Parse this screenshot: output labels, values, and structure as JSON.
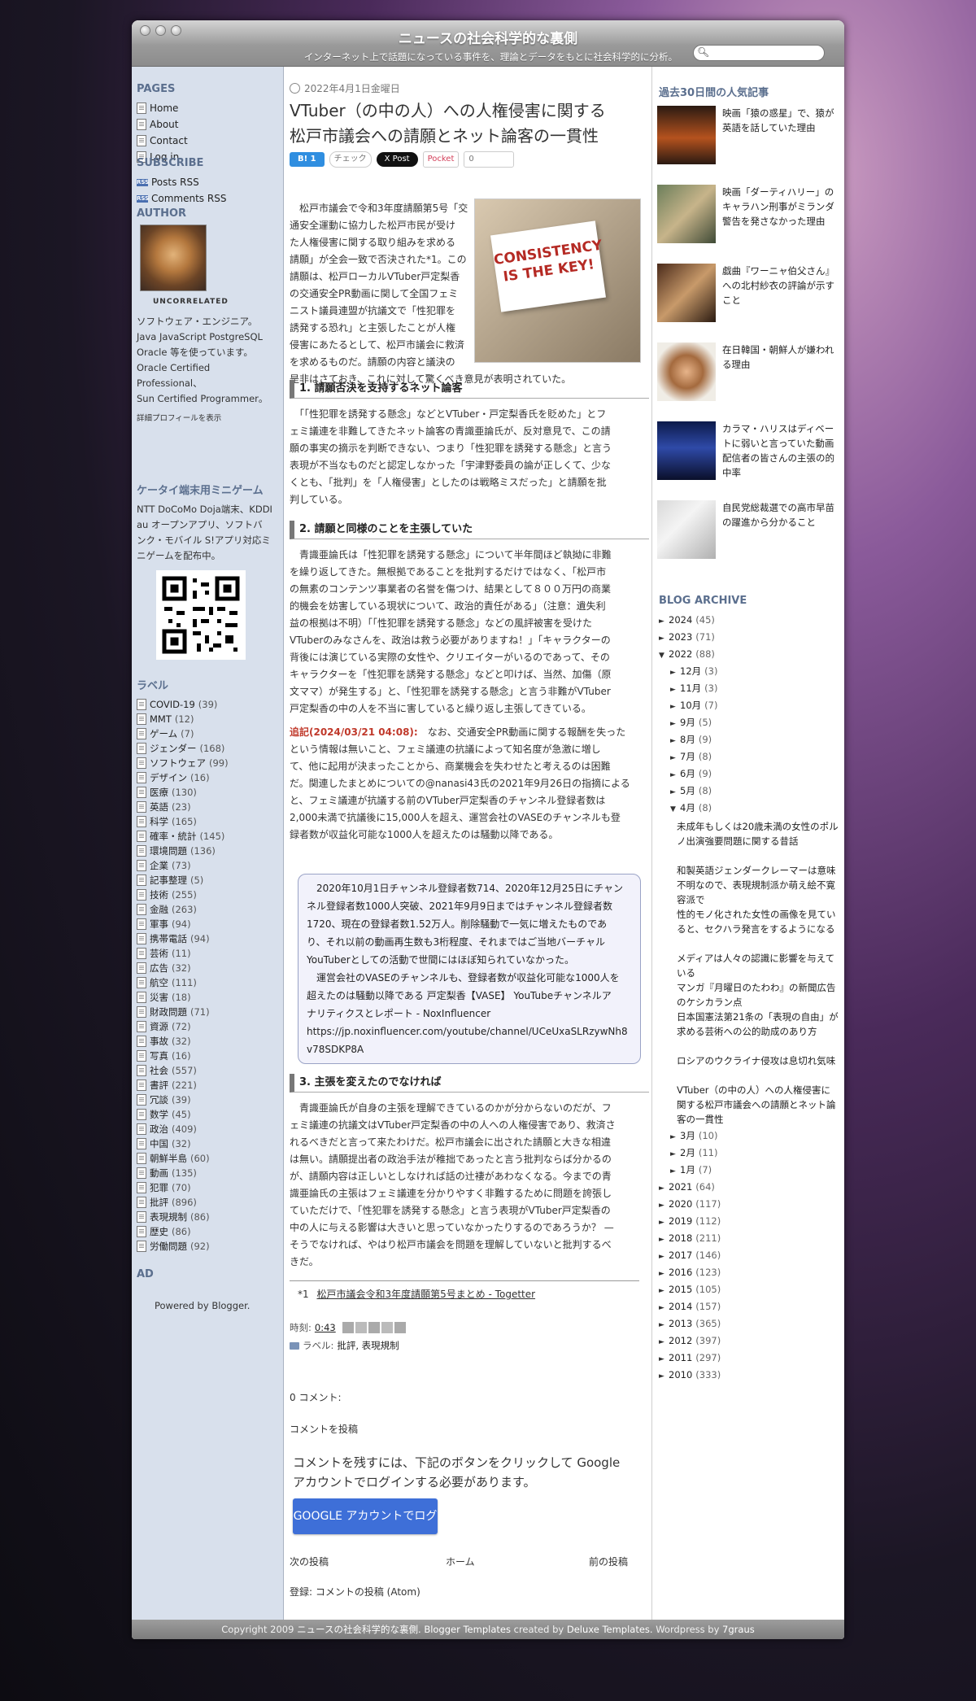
{
  "header": {
    "title": "ニュースの社会科学的な裏側",
    "description": "インターネット上で話題になっている事件を、理論とデータをもとに社会科学的に分析。"
  },
  "left": {
    "pages_title": "PAGES",
    "pages": [
      "Home",
      "About",
      "Contact",
      "Log in"
    ],
    "subscribe_title": "SUBSCRIBE",
    "subscribe": [
      "Posts RSS",
      "Comments RSS"
    ],
    "author_title": "AUTHOR",
    "author_name": "UNCORRELATED",
    "author_bio": [
      "ソフトウェア・エンジニア。",
      "Java JavaScript PostgreSQL",
      "Oracle 等を使っています。",
      "Oracle Certified Professional、",
      "Sun Certified Programmer。"
    ],
    "author_profile_link": "詳細プロフィールを表示",
    "mobile_title": "ケータイ端末用ミニゲーム",
    "mobile_text": [
      "NTT DoCoMo Doja端末、KDDI",
      "au オープンアプリ、ソフトバ",
      "ンク・モバイル S!アプリ対応ミ",
      "ニゲームを配布中。"
    ],
    "labels_title": "ラベル",
    "labels": [
      {
        "name": "COVID-19",
        "count": "(39)"
      },
      {
        "name": "MMT",
        "count": "(12)"
      },
      {
        "name": "ゲーム",
        "count": "(7)"
      },
      {
        "name": "ジェンダー",
        "count": "(168)"
      },
      {
        "name": "ソフトウェア",
        "count": "(99)"
      },
      {
        "name": "デザイン",
        "count": "(16)"
      },
      {
        "name": "医療",
        "count": "(130)"
      },
      {
        "name": "英語",
        "count": "(23)"
      },
      {
        "name": "科学",
        "count": "(165)"
      },
      {
        "name": "確率・統計",
        "count": "(145)"
      },
      {
        "name": "環境問題",
        "count": "(136)"
      },
      {
        "name": "企業",
        "count": "(73)"
      },
      {
        "name": "記事整理",
        "count": "(5)"
      },
      {
        "name": "技術",
        "count": "(255)"
      },
      {
        "name": "金融",
        "count": "(263)"
      },
      {
        "name": "軍事",
        "count": "(94)"
      },
      {
        "name": "携帯電話",
        "count": "(94)"
      },
      {
        "name": "芸術",
        "count": "(11)"
      },
      {
        "name": "広告",
        "count": "(32)"
      },
      {
        "name": "航空",
        "count": "(111)"
      },
      {
        "name": "災害",
        "count": "(18)"
      },
      {
        "name": "財政問題",
        "count": "(71)"
      },
      {
        "name": "資源",
        "count": "(72)"
      },
      {
        "name": "事故",
        "count": "(32)"
      },
      {
        "name": "写真",
        "count": "(16)"
      },
      {
        "name": "社会",
        "count": "(557)"
      },
      {
        "name": "書評",
        "count": "(221)"
      },
      {
        "name": "冗談",
        "count": "(39)"
      },
      {
        "name": "数学",
        "count": "(45)"
      },
      {
        "name": "政治",
        "count": "(409)"
      },
      {
        "name": "中国",
        "count": "(32)"
      },
      {
        "name": "朝鮮半島",
        "count": "(60)"
      },
      {
        "name": "動画",
        "count": "(135)"
      },
      {
        "name": "犯罪",
        "count": "(70)"
      },
      {
        "name": "批評",
        "count": "(896)"
      },
      {
        "name": "表現規制",
        "count": "(86)"
      },
      {
        "name": "歴史",
        "count": "(86)"
      },
      {
        "name": "労働問題",
        "count": "(92)"
      }
    ],
    "ad_title": "AD",
    "powered_prefix": "Powered by",
    "powered_link": "Blogger."
  },
  "post": {
    "date": "2022年4月1日金曜日",
    "title_line1": "VTuber（の中の人）への人権侵害に関する",
    "title_line2": "松戸市議会への請願とネット論客の一貫性",
    "share": {
      "hatena": "B! 1",
      "check": "チェック",
      "x": "X Post",
      "pocket": "Pocket",
      "pocket_count": "0"
    },
    "image_text_line1": "CONSISTENCY",
    "image_text_line2": "IS THE KEY!",
    "intro": [
      "　松戸市議会で令和3年度請願第5号「交",
      "通安全運動に協力した松戸市民が受け",
      "た人権侵害に関する取り組みを求める",
      "請願」が全会一致で否決された*1。この",
      "請願は、松戸ローカルVTuber戸定梨香",
      "の交通安全PR動画に関して全国フェミ",
      "ニスト議員連盟が抗議文で「性犯罪を",
      "誘発する恐れ」と主張したことが人権",
      "侵害にあたるとして、松戸市議会に救済",
      "を求めるものだ。請願の内容と議決の",
      "是非はさておき、これに対して驚くべき意見が表明されていた。"
    ],
    "h1": "1. 請願否決を支持するネット論客",
    "s1": [
      "　「「性犯罪を誘発する懸念」などとVTuber・戸定梨香氏を貶めた」とフ",
      "ェミ議連を非難してきたネット論客の青識亜論氏が、反対意見で、この請",
      "願の事実の摘示を判断できない、つまり「性犯罪を誘発する懸念」と言う",
      "表現が不当なものだと認定しなかった「宇津野委員の論が正しくて、少な",
      "くとも、「批判」を「人権侵害」としたのは戦略ミスだった」と請願を批",
      "判している。"
    ],
    "h2": "2. 請願と同様のことを主張していた",
    "s2": [
      "　青識亜論氏は「性犯罪を誘発する懸念」について半年間ほど執拗に非難",
      "を繰り返してきた。無根拠であることを批判するだけではなく、「松戸市",
      "の無素のコンテンツ事業者の名誉を傷つけ、結果として８００万円の商業",
      "的機会を妨害している現状について、政治的責任がある」（注意：遺失利",
      "益の根拠は不明）「「性犯罪を誘発する懸念」などの風評被害を受けた",
      "VTuberのみなさんを、政治は救う必要がありますね！」「キャラクターの",
      "背後には演じている実際の女性や、クリエイターがいるのであって、その",
      "キャラクターを「性犯罪を誘発する懸念」などと叩けば、当然、加傷（原",
      "文ママ）が発生する」と、「性犯罪を誘発する懸念」と言う非難がVTuber",
      "戸定梨香の中の人を不当に害していると繰り返し主張してきている。"
    ],
    "addendum_label": "追記(2024/03/21 04:08):",
    "addendum": [
      "　なお、交通安全PR動画に関する報酬を失った",
      "という情報は無いこと、フェミ議連の抗議によって知名度が急激に増し",
      "て、他に起用が決まったことから、商業機会を失わせたと考えるのは困難",
      "だ。関連したまとめについての@nanasi43氏の2021年9月26日の指摘によると、フェミ議連が抗議する前のVTuber戸定梨香のチャンネル登録者数は",
      "2,000未満で抗議後に15,000人を超え、運営会社のVASEのチャンネルも登",
      "録者数が収益化可能な1000人を超えたのは騒動以降である。"
    ],
    "quote": [
      "　2020年10月1日チャンネル登録者数714、2020年12月25日にチャン",
      "ネル登録者数1000人突破、2021年9月9日まではチャンネル登録者数",
      "1720、現在の登録者数1.52万人。削除騒動で一気に増えたものであ",
      "り、それ以前の動画再生数も3桁程度、それまではご当地バーチャル",
      "YouTuberとしての活動で世間にはほぼ知られていなかった。",
      "　運営会社のVASEのチャンネルも、登録者数が収益化可能な1000人を",
      "超えたのは騒動以降である 戸定梨香【VASE】 YouTubeチャンネルア",
      "ナリティクスとレポート - NoxInfluencer",
      "https://jp.noxinfluencer.com/youtube/channel/UCeUxaSLRzywNh8",
      "v78SDKP8A"
    ],
    "h3": "3. 主張を変えたのでなければ",
    "s3": [
      "　青識亜論氏が自身の主張を理解できているのかが分からないのだが、フ",
      "ェミ議連の抗議文はVTuber戸定梨香の中の人への人権侵害であり、救済さ",
      "れるべきだと言って来たわけだ。松戸市議会に出された請願と大きな相違",
      "は無い。請願提出者の政治手法が稚拙であったと言う批判ならば分かるの",
      "が、請願内容は正しいとしなければ話の辻褄があわなくなる。今までの青",
      "識亜論氏の主張はフェミ議連を分かりやすく非難するために問題を誇張し",
      "ていただけで、「性犯罪を誘発する懸念」と言う表現がVTuber戸定梨香の",
      "中の人に与える影響は大きいと思っていなかったりするのであろうか？ —",
      "そうでなければ、やはり松戸市議会を問題を理解していないと批判するべ",
      "きだ。"
    ],
    "footnote_mark": "*1",
    "footnote": "松戸市議会令和3年度請願第5号まとめ - Togetter",
    "time_label": "時刻:",
    "time": "0:43",
    "labels_prefix": "ラベル:",
    "labels": "批評, 表現規制",
    "comments_count": "0 コメント:",
    "comment_post": "コメントを投稿",
    "login_notice_line1": "コメントを残すには、下記のボタンをクリックして Google",
    "login_notice_line2": "アカウントでログインする必要があります。",
    "google_button": "GOOGLE アカウントでログイン",
    "nav_newer": "次の投稿",
    "nav_home": "ホーム",
    "nav_older": "前の投稿",
    "subscribe_label": "登録: コメントの投稿 (Atom)"
  },
  "right": {
    "popular_title": "過去30日間の人気記事",
    "popular": [
      "映画「猿の惑星」で、猿が英語を話していた理由",
      "映画「ダーティハリー」のキャラハン刑事がミランダ警告を発さなかった理由",
      "戯曲『ワーニャ伯父さん』への北村紗衣の評論が示すこと",
      "在日韓国・朝鮮人が嫌われる理由",
      "カラマ・ハリスはディベートに弱いと言っていた動画配信者の皆さんの主張の的中率",
      "自民党総裁選での高市早苗の躍進から分かること"
    ],
    "archive_title": "BLOG ARCHIVE",
    "years_before": [
      {
        "year": "2024",
        "count": "(45)"
      },
      {
        "year": "2023",
        "count": "(71)"
      },
      {
        "year": "2022",
        "count": "(88)"
      }
    ],
    "months_2022": [
      {
        "month": "12月",
        "count": "(3)"
      },
      {
        "month": "11月",
        "count": "(3)"
      },
      {
        "month": "10月",
        "count": "(7)"
      },
      {
        "month": "9月",
        "count": "(5)"
      },
      {
        "month": "8月",
        "count": "(9)"
      },
      {
        "month": "7月",
        "count": "(8)"
      },
      {
        "month": "6月",
        "count": "(9)"
      },
      {
        "month": "5月",
        "count": "(8)"
      },
      {
        "month": "4月",
        "count": "(8)"
      }
    ],
    "april_posts": [
      "未成年もしくは20歳未満の女性のポルノ出演強要問題に関する昔話",
      "和製英語ジェンダークレーマーは意味不明なので、表現規制派か萌え絵不寛容派で",
      "性的モノ化された女性の画像を見ていると、セクハラ発言をするようになる",
      "メディアは人々の認識に影響を与えている",
      "マンガ『月曜日のたわわ』の新聞広告のケシカラン点",
      "日本国憲法第21条の「表現の自由」が求める芸術への公的助成のあり方",
      "ロシアのウクライナ侵攻は息切れ気味",
      "VTuber（の中の人）への人権侵害に関する松戸市議会への請願とネット論客の一貫性"
    ],
    "months_after": [
      {
        "month": "3月",
        "count": "(10)"
      },
      {
        "month": "2月",
        "count": "(11)"
      },
      {
        "month": "1月",
        "count": "(7)"
      }
    ],
    "years_after": [
      {
        "year": "2021",
        "count": "(64)"
      },
      {
        "year": "2020",
        "count": "(117)"
      },
      {
        "year": "2019",
        "count": "(112)"
      },
      {
        "year": "2018",
        "count": "(211)"
      },
      {
        "year": "2017",
        "count": "(146)"
      },
      {
        "year": "2016",
        "count": "(123)"
      },
      {
        "year": "2015",
        "count": "(105)"
      },
      {
        "year": "2014",
        "count": "(157)"
      },
      {
        "year": "2013",
        "count": "(365)"
      },
      {
        "year": "2012",
        "count": "(397)"
      },
      {
        "year": "2011",
        "count": "(297)"
      },
      {
        "year": "2010",
        "count": "(333)"
      }
    ]
  },
  "footer": {
    "copyright": "Copyright 2009",
    "site": "ニュースの社会科学的な裏側.",
    "templates": "Blogger Templates",
    "created_by": "created by",
    "deluxe": "Deluxe Templates.",
    "wordpress": "Wordpress by",
    "graus": "7graus"
  }
}
